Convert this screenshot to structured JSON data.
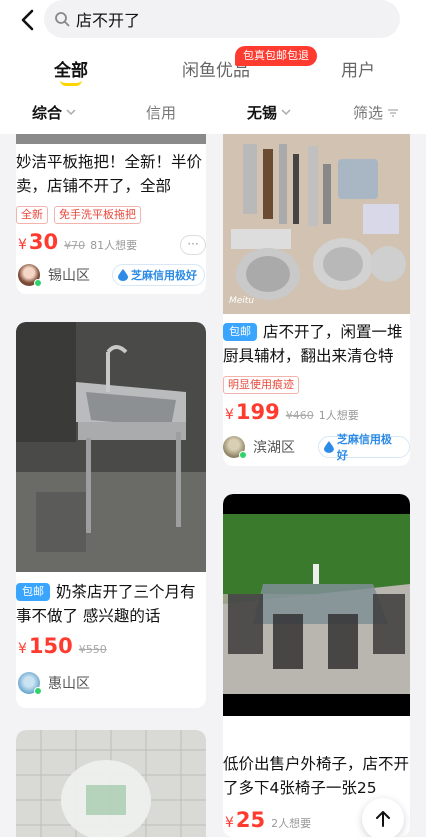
{
  "search": {
    "query": "店不开了"
  },
  "tabs": [
    {
      "label": "全部"
    },
    {
      "label": "闲鱼优品"
    },
    {
      "label": "用户"
    }
  ],
  "promo_badge": "包真包邮包退",
  "filters": [
    {
      "label": "综合"
    },
    {
      "label": "信用"
    },
    {
      "label": "无锡"
    },
    {
      "label": "筛选"
    }
  ],
  "cards": {
    "c1": {
      "title": "妙洁平板拖把！全新！半价卖，店铺不开了，全部",
      "tags": [
        "全新",
        "免手洗平板拖把"
      ],
      "price": "30",
      "orig": "¥70",
      "wants": "81人想要",
      "area": "锡山区",
      "credit": "芝麻信用极好",
      "more": "···"
    },
    "c2": {
      "badge": "包邮",
      "title": "店不开了，闲置一堆厨具辅材，翻出来清仓特",
      "tags": [
        "明显使用痕迹"
      ],
      "price": "199",
      "orig": "¥460",
      "wants": "1人想要",
      "area": "滨湖区",
      "credit": "芝麻信用极好",
      "watermark": "Meitu"
    },
    "c3": {
      "badge": "包邮",
      "title": "奶茶店开了三个月有事不做了 感兴趣的话",
      "price": "150",
      "orig": "¥550",
      "area": "惠山区"
    },
    "c4": {
      "title": "低价出售户外椅子，店不开了多下4张椅子一张25",
      "price": "25",
      "wants": "2人想要"
    }
  },
  "currency": "¥",
  "colors": {
    "accent": "#ff3b30",
    "brand_yellow": "#ffd500",
    "credit_blue": "#2c8be6"
  }
}
